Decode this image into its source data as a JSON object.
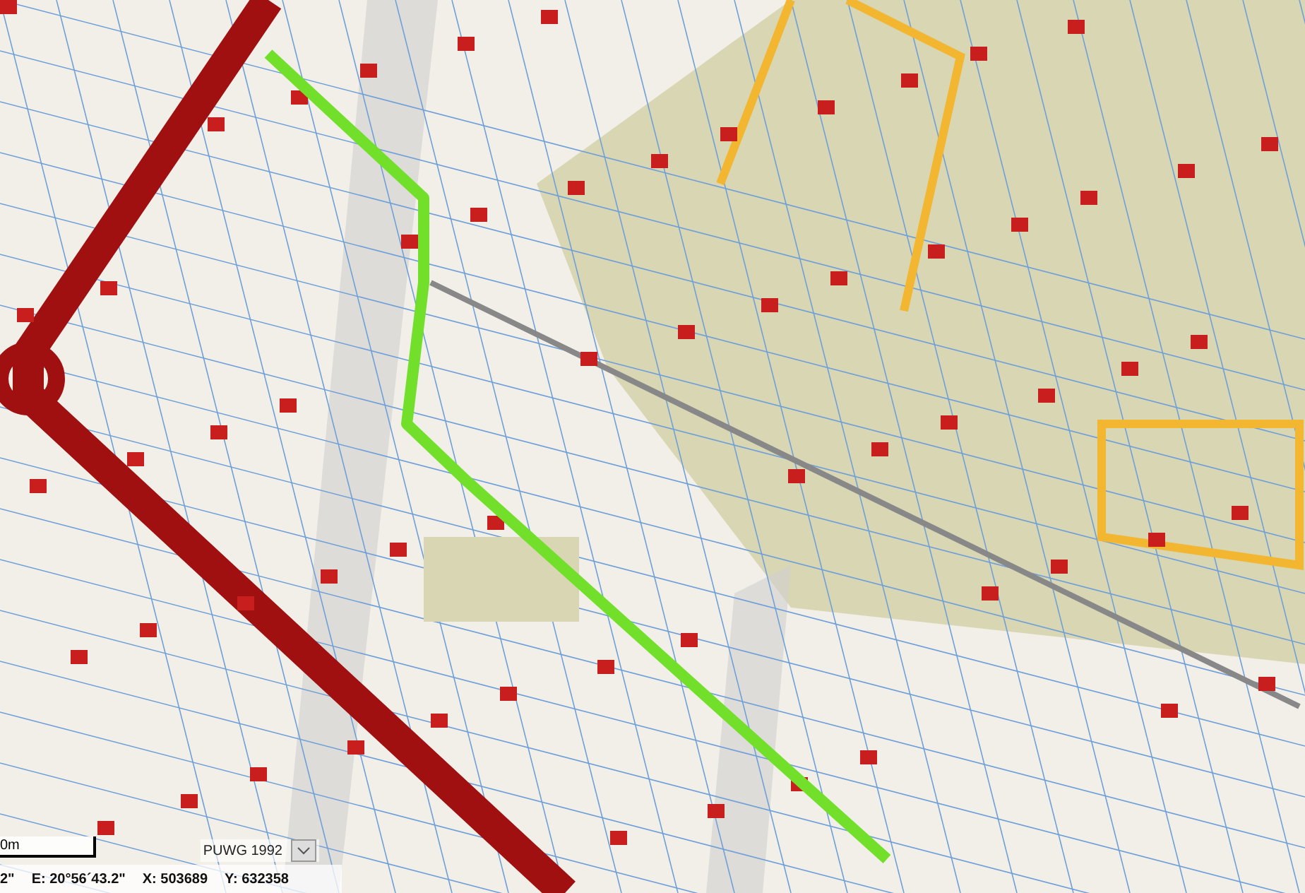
{
  "scale_bar": {
    "label": "0m"
  },
  "coordinate_system": {
    "value": "PUWG 1992"
  },
  "coordinates": [
    {
      "text": "2\""
    },
    {
      "text": "E: 20°56´43.2\""
    },
    {
      "text": "X: 503689"
    },
    {
      "text": "Y: 632358"
    }
  ]
}
